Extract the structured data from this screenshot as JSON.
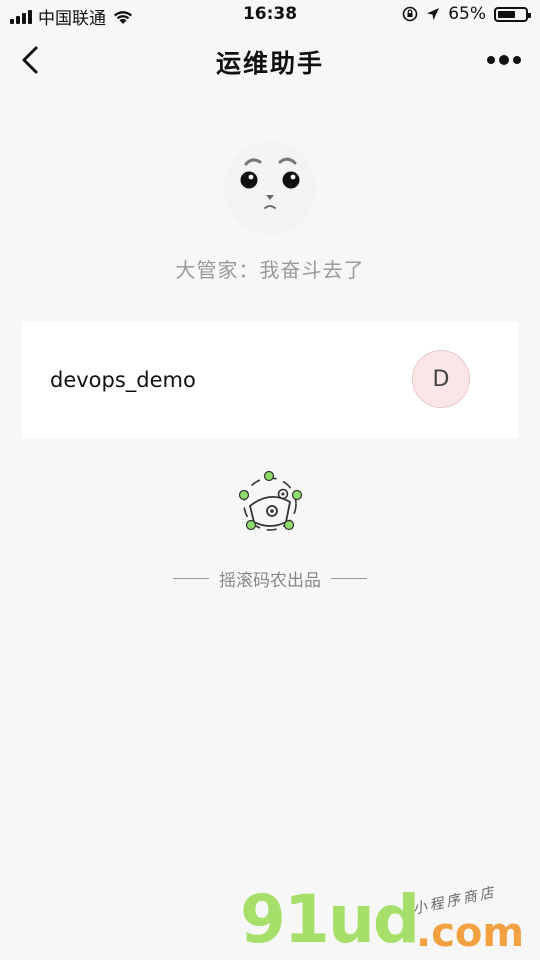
{
  "status_bar": {
    "carrier": "中国联通",
    "time": "16:38",
    "battery_percent": "65%",
    "battery_level": 0.65
  },
  "nav": {
    "title": "运维助手",
    "back_icon": "chevron-left-icon",
    "more_icon": "more-dots-icon"
  },
  "profile": {
    "slogan": "大管家：我奋斗去了"
  },
  "project": {
    "name": "devops_demo",
    "badge": "D"
  },
  "footer": {
    "text": "摇滚码农出品"
  },
  "watermark": {
    "brand": "91ud",
    "domain": ".com",
    "tagline": "小程序商店"
  },
  "colors": {
    "badge_bg": "#fbe5e6",
    "logo_green": "#8edc6a",
    "watermark_green": "#a6e06a",
    "watermark_orange": "#f2a040"
  }
}
